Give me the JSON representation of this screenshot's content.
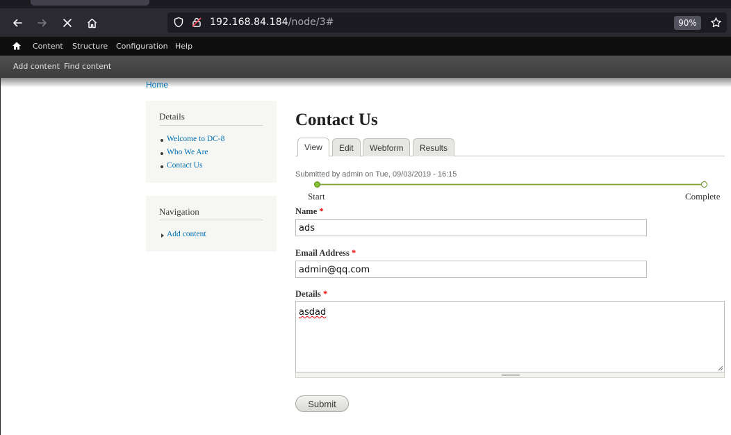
{
  "browser": {
    "url_host": "192.168.84.184",
    "url_path": "/node/3#",
    "zoom": "90%"
  },
  "toolbar": {
    "items": [
      "Content",
      "Structure",
      "Configuration",
      "Help"
    ],
    "sub_items": [
      "Add content",
      "Find content"
    ]
  },
  "breadcrumb": "Home",
  "sidebar": {
    "details": {
      "title": "Details",
      "links": [
        "Welcome to DC-8",
        "Who We Are",
        "Contact Us"
      ]
    },
    "navigation": {
      "title": "Navigation",
      "links": [
        "Add content"
      ]
    }
  },
  "main": {
    "title": "Contact Us",
    "tabs": [
      "View",
      "Edit",
      "Webform",
      "Results"
    ],
    "submitted": "Submitted by admin on Tue, 09/03/2019 - 16:15",
    "progress": {
      "start": "Start",
      "end": "Complete"
    },
    "form": {
      "name_label": "Name",
      "name_value": "ads",
      "email_label": "Email Address",
      "email_value": "admin@qq.com",
      "details_label": "Details",
      "details_value": "asdad",
      "required_marker": "*",
      "submit": "Submit"
    }
  }
}
